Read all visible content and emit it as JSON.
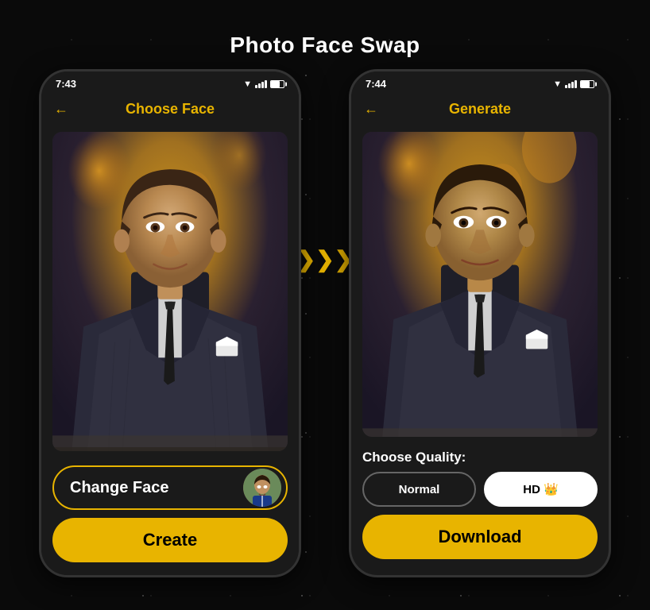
{
  "page": {
    "title": "Photo Face Swap",
    "bg_color": "#0a0a0a"
  },
  "left_phone": {
    "status_time": "7:43",
    "header_title": "Choose Face",
    "back_label": "←",
    "change_face_label": "Change Face",
    "create_label": "Create"
  },
  "right_phone": {
    "status_time": "7:44",
    "header_title": "Generate",
    "back_label": "←",
    "quality_label": "Choose Quality:",
    "normal_label": "Normal",
    "hd_label": "HD 👑",
    "download_label": "Download"
  },
  "icons": {
    "chevrons": "❯❯❯❯❯"
  }
}
